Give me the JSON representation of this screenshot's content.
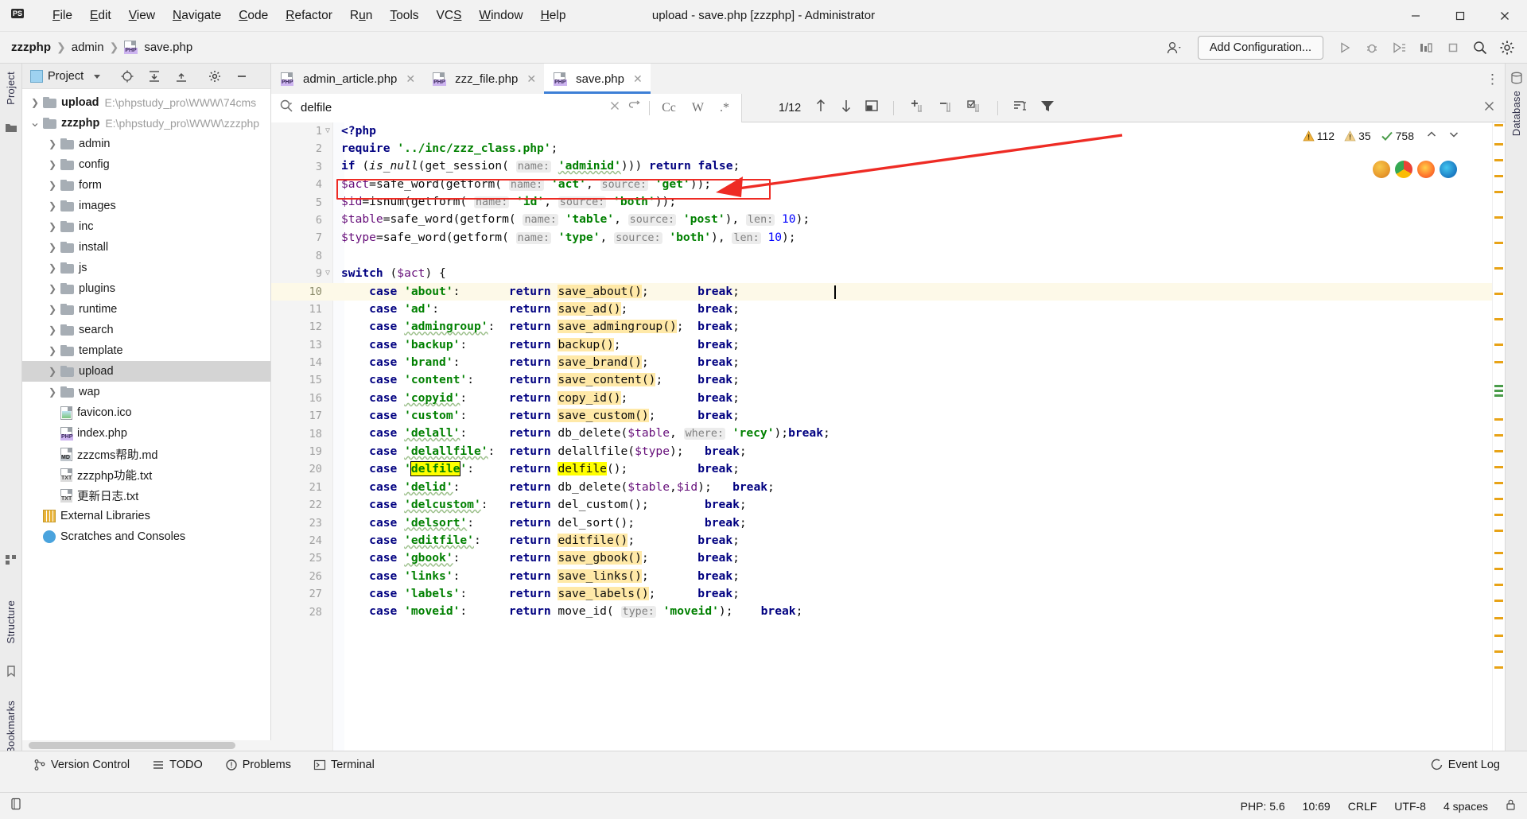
{
  "window": {
    "title": "upload - save.php [zzzphp] - Administrator",
    "app_icon": "phpstorm-logo",
    "minimize": "minimize-icon",
    "maximize": "maximize-icon",
    "close": "close-icon"
  },
  "menu": [
    {
      "label": "File"
    },
    {
      "label": "Edit"
    },
    {
      "label": "View"
    },
    {
      "label": "Navigate"
    },
    {
      "label": "Code"
    },
    {
      "label": "Refactor"
    },
    {
      "label": "Run"
    },
    {
      "label": "Tools"
    },
    {
      "label": "VCS"
    },
    {
      "label": "Window"
    },
    {
      "label": "Help"
    }
  ],
  "navbar": {
    "breadcrumb": [
      "zzzphp",
      "admin",
      "save.php"
    ],
    "add_configuration": "Add Configuration...",
    "buttons": [
      "user-icon",
      "run-icon",
      "debug-icon",
      "run-with-coverage-icon",
      "profile-icon",
      "stop-icon",
      "search-everywhere-icon",
      "settings-icon"
    ]
  },
  "left_rail": {
    "project_label": "Project",
    "structure_label": "Structure",
    "bookmarks_label": "Bookmarks"
  },
  "right_rail": {
    "database_label": "Database"
  },
  "project_panel": {
    "title": "Project",
    "toolbar": [
      "chevron-down-icon",
      "locate-icon",
      "expand-all-icon",
      "collapse-all-icon",
      "settings-icon",
      "hide-icon"
    ],
    "tree": [
      {
        "indent": 0,
        "arrow": "chevron-right-icon",
        "type": "folder",
        "label": "upload",
        "bold": true,
        "path": "E:\\phpstudy_pro\\WWW\\74cms",
        "selected": false
      },
      {
        "indent": 0,
        "arrow": "chevron-down-icon",
        "type": "folder",
        "label": "zzzphp",
        "bold": true,
        "path": "E:\\phpstudy_pro\\WWW\\zzzphp",
        "selected": false
      },
      {
        "indent": 1,
        "arrow": "chevron-right-icon",
        "type": "folder",
        "label": "admin",
        "bold": false,
        "path": "",
        "selected": false
      },
      {
        "indent": 1,
        "arrow": "chevron-right-icon",
        "type": "folder",
        "label": "config",
        "bold": false,
        "path": "",
        "selected": false
      },
      {
        "indent": 1,
        "arrow": "chevron-right-icon",
        "type": "folder",
        "label": "form",
        "bold": false,
        "path": "",
        "selected": false
      },
      {
        "indent": 1,
        "arrow": "chevron-right-icon",
        "type": "folder",
        "label": "images",
        "bold": false,
        "path": "",
        "selected": false
      },
      {
        "indent": 1,
        "arrow": "chevron-right-icon",
        "type": "folder",
        "label": "inc",
        "bold": false,
        "path": "",
        "selected": false
      },
      {
        "indent": 1,
        "arrow": "chevron-right-icon",
        "type": "folder",
        "label": "install",
        "bold": false,
        "path": "",
        "selected": false
      },
      {
        "indent": 1,
        "arrow": "chevron-right-icon",
        "type": "folder",
        "label": "js",
        "bold": false,
        "path": "",
        "selected": false
      },
      {
        "indent": 1,
        "arrow": "chevron-right-icon",
        "type": "folder",
        "label": "plugins",
        "bold": false,
        "path": "",
        "selected": false
      },
      {
        "indent": 1,
        "arrow": "chevron-right-icon",
        "type": "folder",
        "label": "runtime",
        "bold": false,
        "path": "",
        "selected": false
      },
      {
        "indent": 1,
        "arrow": "chevron-right-icon",
        "type": "folder",
        "label": "search",
        "bold": false,
        "path": "",
        "selected": false
      },
      {
        "indent": 1,
        "arrow": "chevron-right-icon",
        "type": "folder",
        "label": "template",
        "bold": false,
        "path": "",
        "selected": false
      },
      {
        "indent": 1,
        "arrow": "chevron-right-icon",
        "type": "folder",
        "label": "upload",
        "bold": false,
        "path": "",
        "selected": true
      },
      {
        "indent": 1,
        "arrow": "chevron-right-icon",
        "type": "folder",
        "label": "wap",
        "bold": false,
        "path": "",
        "selected": false
      },
      {
        "indent": 1,
        "arrow": "",
        "type": "file-ico",
        "label": "favicon.ico",
        "bold": false,
        "path": "",
        "selected": false
      },
      {
        "indent": 1,
        "arrow": "",
        "type": "file-php",
        "label": "index.php",
        "bold": false,
        "path": "",
        "selected": false
      },
      {
        "indent": 1,
        "arrow": "",
        "type": "file-md",
        "label": "zzzcms帮助.md",
        "bold": false,
        "path": "",
        "selected": false
      },
      {
        "indent": 1,
        "arrow": "",
        "type": "file-txt",
        "label": "zzzphp功能.txt",
        "bold": false,
        "path": "",
        "selected": false
      },
      {
        "indent": 1,
        "arrow": "",
        "type": "file-txt",
        "label": "更新日志.txt",
        "bold": false,
        "path": "",
        "selected": false
      },
      {
        "indent": 0,
        "arrow": "",
        "type": "library",
        "label": "External Libraries",
        "bold": false,
        "path": "",
        "selected": false
      },
      {
        "indent": 0,
        "arrow": "",
        "type": "scratches",
        "label": "Scratches and Consoles",
        "bold": false,
        "path": "",
        "selected": false
      }
    ]
  },
  "editor_tabs": [
    {
      "label": "admin_article.php",
      "icon": "php-file-icon",
      "active": false,
      "close": "close-icon"
    },
    {
      "label": "zzz_file.php",
      "icon": "php-file-icon",
      "active": false,
      "close": "close-icon"
    },
    {
      "label": "save.php",
      "icon": "php-file-icon",
      "active": true,
      "close": "close-icon"
    }
  ],
  "search": {
    "icon": "search-icon",
    "query": "delfile",
    "clear": "close-icon",
    "history": "return-icon",
    "match_case": "Cc",
    "words": "W",
    "regex": ".*",
    "counter": "1/12",
    "prev": "arrow-up-icon",
    "next": "arrow-down-icon",
    "select_all": "select-all-icon",
    "add_line": "add-line-icon",
    "remove_line": "remove-line-icon",
    "select_lines": "select-lines-icon",
    "filter_sort": "sort-icon",
    "filter": "filter-icon",
    "close_panel": "close-icon"
  },
  "inspections": {
    "warnings": "112",
    "weak_warnings": "35",
    "ok": "758",
    "up": "chevron-up-icon",
    "down": "chevron-down-icon"
  },
  "browsers": [
    "ie-icon",
    "chrome-icon",
    "firefox-icon",
    "edge-icon"
  ],
  "code": {
    "lines": [
      {
        "n": "1",
        "fold": "fold-icon",
        "cur": false,
        "html": "<span class=\"kw\">&lt;?php</span>"
      },
      {
        "n": "2",
        "fold": "",
        "cur": false,
        "html": "<span class=\"kw\">require</span> <span class=\"str\">'../inc/zzz_class.php'</span>;"
      },
      {
        "n": "3",
        "fold": "",
        "cur": false,
        "html": "<span class=\"kw\">if</span> (<span class=\"ital\">is_null</span>(get_session( <span class=\"hint\">name:</span> <span class=\"str wavy\">'adminid'</span>))) <span class=\"kw\">return</span> <span class=\"kw\">false</span>;"
      },
      {
        "n": "4",
        "fold": "",
        "cur": false,
        "html": "<span class=\"var\">$act</span>=safe_word(getform( <span class=\"hint\">name:</span> <span class=\"str\">'act'</span>, <span class=\"hint\">source:</span> <span class=\"str\">'get'</span>));"
      },
      {
        "n": "5",
        "fold": "",
        "cur": false,
        "html": "<span class=\"var\">$id</span>=isnum(getform( <span class=\"hint\">name:</span> <span class=\"str\">'id'</span>, <span class=\"hint\">source:</span> <span class=\"str\">'both'</span>));"
      },
      {
        "n": "6",
        "fold": "",
        "cur": false,
        "html": "<span class=\"var\">$table</span>=safe_word(getform( <span class=\"hint\">name:</span> <span class=\"str\">'table'</span>, <span class=\"hint\">source:</span> <span class=\"str\">'post'</span>), <span class=\"hint\">len:</span> <span class=\"num2\">10</span>);"
      },
      {
        "n": "7",
        "fold": "",
        "cur": false,
        "html": "<span class=\"var\">$type</span>=safe_word(getform( <span class=\"hint\">name:</span> <span class=\"str\">'type'</span>, <span class=\"hint\">source:</span> <span class=\"str\">'both'</span>), <span class=\"hint\">len:</span> <span class=\"num2\">10</span>);"
      },
      {
        "n": "8",
        "fold": "",
        "cur": false,
        "html": ""
      },
      {
        "n": "9",
        "fold": "fold-icon",
        "cur": false,
        "html": "<span class=\"kw\">switch</span> (<span class=\"var\">$act</span>) {"
      },
      {
        "n": "10",
        "fold": "",
        "cur": true,
        "html": "    <span class=\"kw\">case</span> <span class=\"str\">'about'</span>:       <span class=\"kw\">return</span> <span class=\"hl\">save_about()</span>;       <span class=\"kw\">break</span>;"
      },
      {
        "n": "11",
        "fold": "",
        "cur": false,
        "html": "    <span class=\"kw\">case</span> <span class=\"str\">'ad'</span>:          <span class=\"kw\">return</span> <span class=\"hl\">save_ad()</span>;          <span class=\"kw\">break</span>;"
      },
      {
        "n": "12",
        "fold": "",
        "cur": false,
        "html": "    <span class=\"kw\">case</span> <span class=\"str wavy\">'admingroup'</span>:  <span class=\"kw\">return</span> <span class=\"hl\">save_admingroup()</span>;  <span class=\"kw\">break</span>;"
      },
      {
        "n": "13",
        "fold": "",
        "cur": false,
        "html": "    <span class=\"kw\">case</span> <span class=\"str\">'backup'</span>:      <span class=\"kw\">return</span> <span class=\"hl\">backup()</span>;           <span class=\"kw\">break</span>;"
      },
      {
        "n": "14",
        "fold": "",
        "cur": false,
        "html": "    <span class=\"kw\">case</span> <span class=\"str\">'brand'</span>:       <span class=\"kw\">return</span> <span class=\"hl\">save_brand()</span>;       <span class=\"kw\">break</span>;"
      },
      {
        "n": "15",
        "fold": "",
        "cur": false,
        "html": "    <span class=\"kw\">case</span> <span class=\"str\">'content'</span>:     <span class=\"kw\">return</span> <span class=\"hl\">save_content()</span>;     <span class=\"kw\">break</span>;"
      },
      {
        "n": "16",
        "fold": "",
        "cur": false,
        "html": "    <span class=\"kw\">case</span> <span class=\"str wavy\">'copyid'</span>:      <span class=\"kw\">return</span> <span class=\"hl\">copy_id()</span>;          <span class=\"kw\">break</span>;"
      },
      {
        "n": "17",
        "fold": "",
        "cur": false,
        "html": "    <span class=\"kw\">case</span> <span class=\"str\">'custom'</span>:      <span class=\"kw\">return</span> <span class=\"hl\">save_custom()</span>;      <span class=\"kw\">break</span>;"
      },
      {
        "n": "18",
        "fold": "",
        "cur": false,
        "html": "    <span class=\"kw\">case</span> <span class=\"str wavy\">'delall'</span>:      <span class=\"kw\">return</span> db_delete(<span class=\"var\">$table</span>, <span class=\"hint\">where:</span> <span class=\"str\">'recy'</span>);<span class=\"kw\">break</span>;"
      },
      {
        "n": "19",
        "fold": "",
        "cur": false,
        "html": "    <span class=\"kw\">case</span> <span class=\"str wavy\">'delallfile'</span>:  <span class=\"kw\">return</span> delallfile(<span class=\"var\">$type</span>);   <span class=\"kw\">break</span>;"
      },
      {
        "n": "20",
        "fold": "",
        "cur": false,
        "html": "    <span class=\"kw\">case</span> <span class=\"str\">'<span class=\"hlYb\">delfile</span>'</span>:     <span class=\"kw\">return</span> <span class=\"hlY\">delfile</span>();          <span class=\"kw\">break</span>;"
      },
      {
        "n": "21",
        "fold": "",
        "cur": false,
        "html": "    <span class=\"kw\">case</span> <span class=\"str wavy\">'delid'</span>:       <span class=\"kw\">return</span> db_delete(<span class=\"var\">$table</span>,<span class=\"var\">$id</span>);   <span class=\"kw\">break</span>;"
      },
      {
        "n": "22",
        "fold": "",
        "cur": false,
        "html": "    <span class=\"kw\">case</span> <span class=\"str wavy\">'delcustom'</span>:   <span class=\"kw\">return</span> del_custom();        <span class=\"kw\">break</span>;"
      },
      {
        "n": "23",
        "fold": "",
        "cur": false,
        "html": "    <span class=\"kw\">case</span> <span class=\"str wavy\">'delsort'</span>:     <span class=\"kw\">return</span> del_sort();          <span class=\"kw\">break</span>;"
      },
      {
        "n": "24",
        "fold": "",
        "cur": false,
        "html": "    <span class=\"kw\">case</span> <span class=\"str wavy\">'editfile'</span>:    <span class=\"kw\">return</span> <span class=\"hl\">editfile()</span>;         <span class=\"kw\">break</span>;"
      },
      {
        "n": "25",
        "fold": "",
        "cur": false,
        "html": "    <span class=\"kw\">case</span> <span class=\"str wavy\">'gbook'</span>:       <span class=\"kw\">return</span> <span class=\"hl\">save_gbook()</span>;       <span class=\"kw\">break</span>;"
      },
      {
        "n": "26",
        "fold": "",
        "cur": false,
        "html": "    <span class=\"kw\">case</span> <span class=\"str\">'links'</span>:       <span class=\"kw\">return</span> <span class=\"hl\">save_links()</span>;       <span class=\"kw\">break</span>;"
      },
      {
        "n": "27",
        "fold": "",
        "cur": false,
        "html": "    <span class=\"kw\">case</span> <span class=\"str\">'labels'</span>:      <span class=\"kw\">return</span> <span class=\"hl\">save_labels()</span>;      <span class=\"kw\">break</span>;"
      },
      {
        "n": "28",
        "fold": "",
        "cur": false,
        "html": "    <span class=\"kw\">case</span> <span class=\"str\">'moveid'</span>:      <span class=\"kw\">return</span> move_id( <span class=\"hint\">type:</span> <span class=\"str\">'moveid'</span>);    <span class=\"kw\">break</span>;"
      }
    ]
  },
  "bottom_bar": [
    {
      "label": "Version Control",
      "icon": "branch-icon"
    },
    {
      "label": "TODO",
      "icon": "todo-icon"
    },
    {
      "label": "Problems",
      "icon": "problems-icon"
    },
    {
      "label": "Terminal",
      "icon": "terminal-icon"
    }
  ],
  "event_log": {
    "label": "Event Log",
    "icon": "event-log-icon"
  },
  "status_bar": {
    "left_icon": "line-separator-icon",
    "php_version": "PHP: 5.6",
    "caret": "10:69",
    "line_sep": "CRLF",
    "encoding": "UTF-8",
    "indent": "4 spaces",
    "lock": "lock-icon"
  },
  "colors": {
    "accent": "#3d7fd6",
    "annotation_red": "#ee2b24",
    "highlight_yellow": "#ffff00",
    "soft_highlight": "#ffe9a8",
    "warning": "#e8a317",
    "ok_green": "#4a9c4a"
  }
}
